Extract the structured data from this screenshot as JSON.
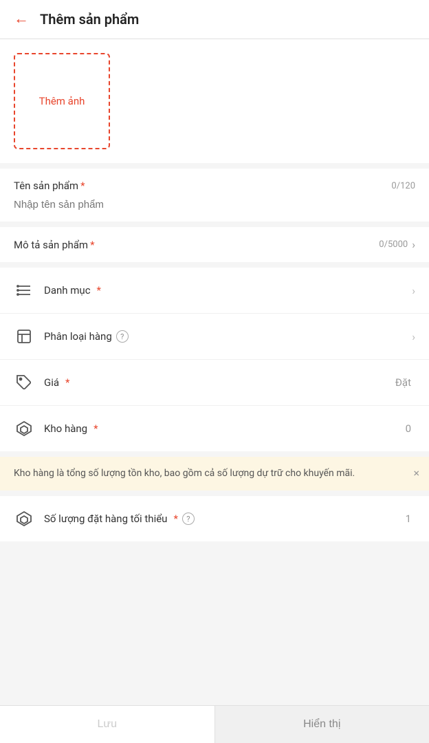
{
  "header": {
    "back_label": "←",
    "title": "Thêm sản phẩm"
  },
  "image_section": {
    "add_image_label": "Thêm ảnh"
  },
  "product_name_field": {
    "label": "Tên sản phẩm",
    "required": "*",
    "count": "0/120",
    "placeholder": "Nhập tên sản phẩm"
  },
  "description_field": {
    "label": "Mô tả sản phẩm",
    "required": "*",
    "count": "0/5000"
  },
  "menu_items": [
    {
      "id": "category",
      "label": "Danh mục",
      "required": true,
      "has_info": false,
      "value": "",
      "show_chevron": true
    },
    {
      "id": "classification",
      "label": "Phân loại hàng",
      "required": false,
      "has_info": true,
      "value": "",
      "show_chevron": true
    },
    {
      "id": "price",
      "label": "Giá",
      "required": true,
      "has_info": false,
      "value": "Đặt",
      "show_chevron": false
    },
    {
      "id": "inventory",
      "label": "Kho hàng",
      "required": true,
      "has_info": false,
      "value": "0",
      "show_chevron": false
    }
  ],
  "info_box": {
    "text": "Kho hàng là tổng số lượng tồn kho, bao gồm cả số lượng dự trữ cho khuyến mãi.",
    "close_label": "×"
  },
  "min_order_item": {
    "label": "Số lượng đặt hàng tối thiểu",
    "required": "*",
    "has_info": true,
    "value": "1"
  },
  "buttons": {
    "save_label": "Lưu",
    "display_label": "Hiển thị"
  }
}
